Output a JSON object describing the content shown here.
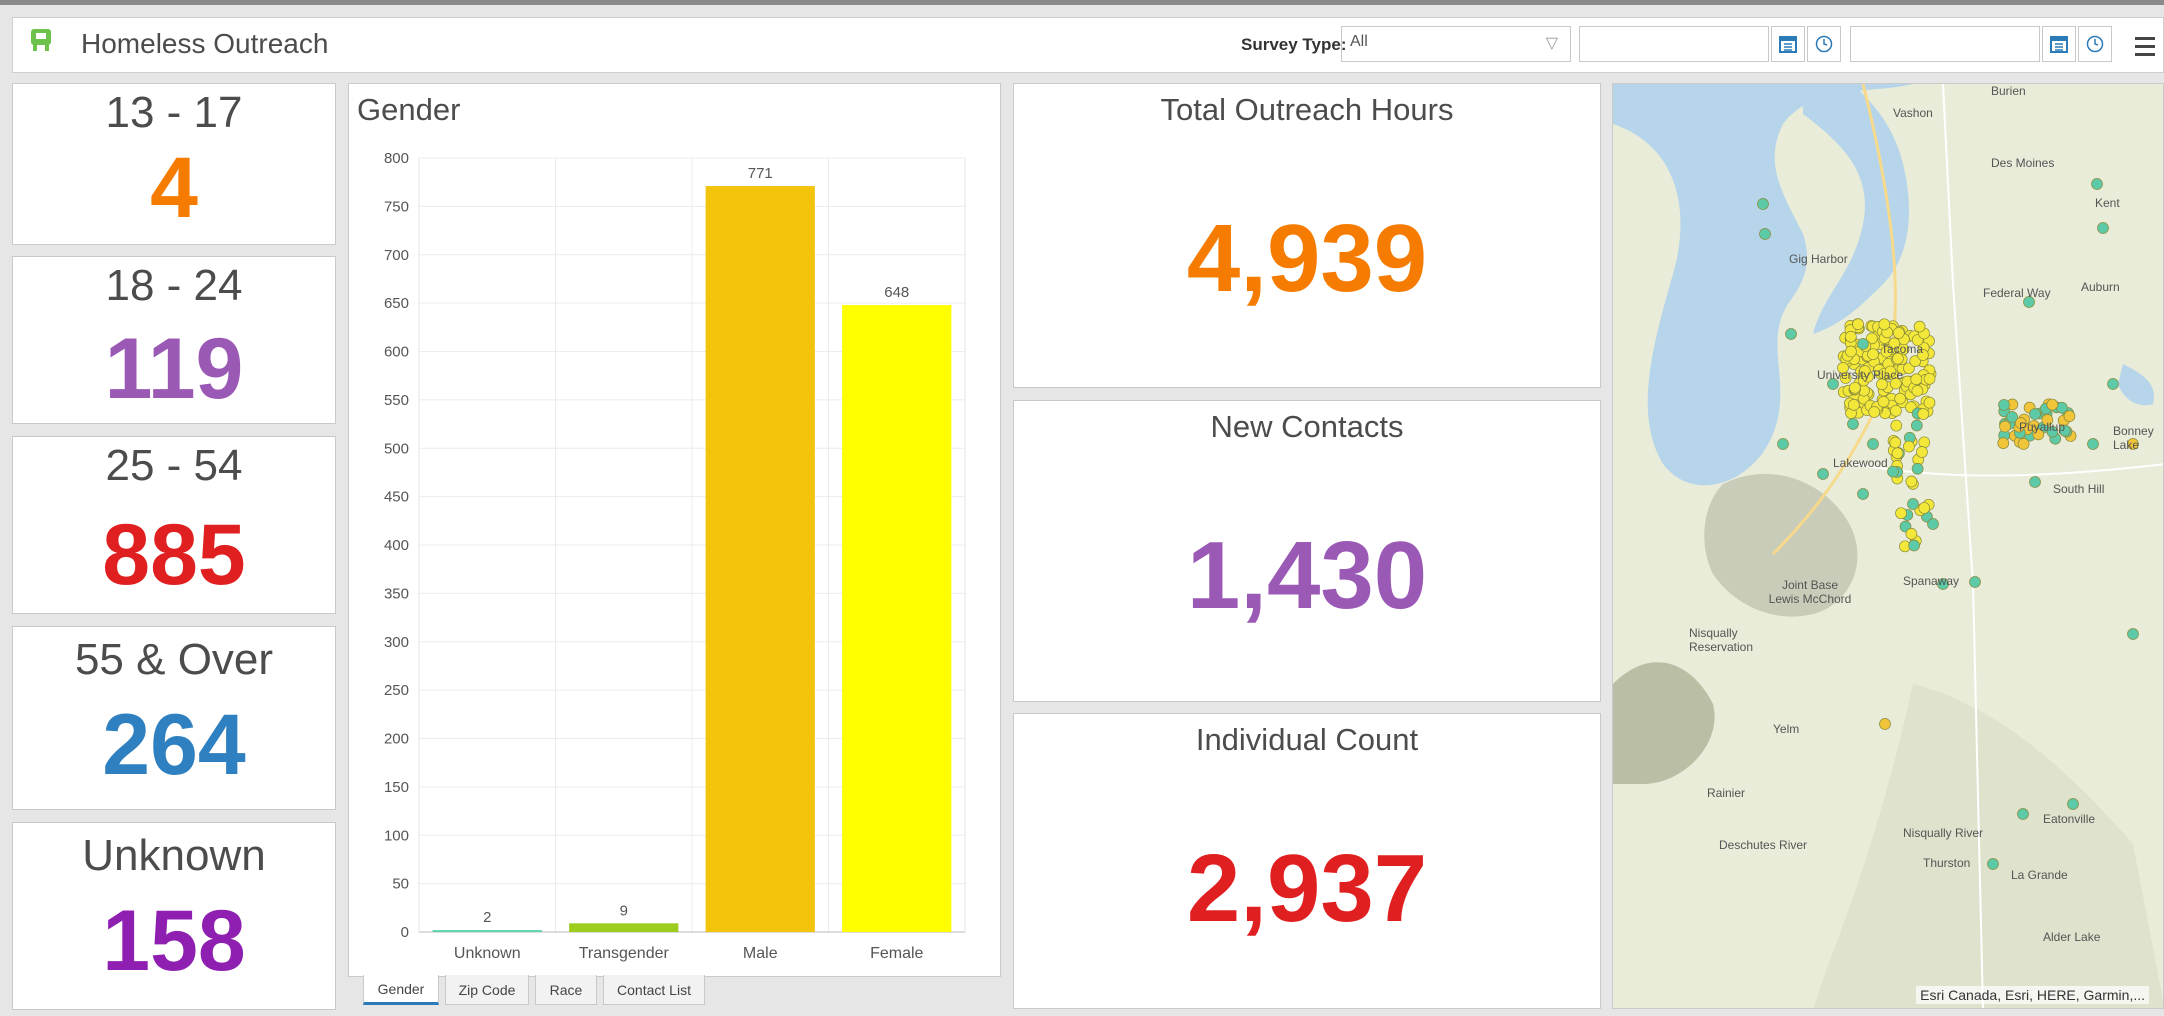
{
  "app": {
    "title": "Homeless Outreach"
  },
  "filters": {
    "survey_type_label": "Survey Type:",
    "survey_type_value": "All",
    "start_date_placeholder": "",
    "end_date_placeholder": ""
  },
  "age_groups": [
    {
      "label": "13 - 17",
      "value": "4",
      "color": "#f57c00"
    },
    {
      "label": "18 - 24",
      "value": "119",
      "color": "#9b59b6"
    },
    {
      "label": "25 - 54",
      "value": "885",
      "color": "#e02020"
    },
    {
      "label": "55 & Over",
      "value": "264",
      "color": "#2f80c0"
    },
    {
      "label": "Unknown",
      "value": "158",
      "color": "#8e1fb0"
    }
  ],
  "gender_chart": {
    "title": "Gender",
    "tabs": [
      "Gender",
      "Zip Code",
      "Race",
      "Contact List"
    ],
    "active_tab": "Gender"
  },
  "chart_data": {
    "type": "bar",
    "title": "Gender",
    "categories": [
      "Unknown",
      "Transgender",
      "Male",
      "Female"
    ],
    "values": [
      2,
      9,
      771,
      648
    ],
    "data_labels": [
      "2",
      "9",
      "771",
      "648"
    ],
    "colors": [
      "#5fd3b0",
      "#9ccc1c",
      "#f2c40c",
      "#ffff00"
    ],
    "ylim": [
      0,
      800
    ],
    "yticks": [
      0,
      50,
      100,
      150,
      200,
      250,
      300,
      350,
      400,
      450,
      500,
      550,
      600,
      650,
      700,
      750,
      800
    ],
    "grid": true
  },
  "stats": [
    {
      "label": "Total Outreach Hours",
      "value": "4,939",
      "color": "#f57c00"
    },
    {
      "label": "New Contacts",
      "value": "1,430",
      "color": "#9b59b6"
    },
    {
      "label": "Individual Count",
      "value": "2,937",
      "color": "#e02020"
    }
  ],
  "map": {
    "places": [
      "Burien",
      "Vashon",
      "Des Moines",
      "Kent",
      "Gig Harbor",
      "Federal Way",
      "Auburn",
      "Tacoma",
      "University Place",
      "Puyallup",
      "Lakewood",
      "South Hill",
      "Bonney Lake",
      "Joint Base Lewis McChord",
      "Nisqually Reservation",
      "Spanaway",
      "Yelm",
      "Rainier",
      "Thurston",
      "Eatonville",
      "La Grande",
      "Alder Lake",
      "Deschutes River",
      "Nisqually River"
    ],
    "attribution": "Esri Canada, Esri, HERE, Garmin,..."
  }
}
